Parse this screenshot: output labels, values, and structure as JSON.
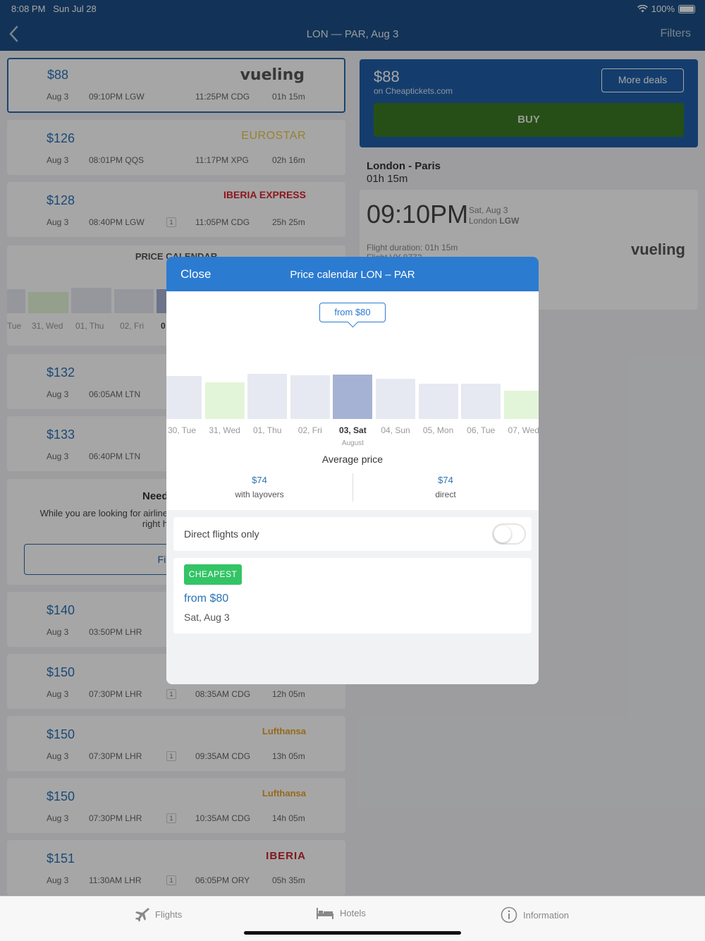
{
  "status": {
    "time": "8:08 PM",
    "date": "Sun Jul 28",
    "battery": "100%"
  },
  "nav": {
    "title": "LON — PAR, Aug 3",
    "filters": "Filters"
  },
  "flights": [
    {
      "price": "$88",
      "date": "Aug 3",
      "depart": "09:10PM LGW",
      "stops": "",
      "arrive": "11:25PM CDG",
      "duration": "01h 15m",
      "airline": "vueling",
      "selected": true
    },
    {
      "price": "$126",
      "date": "Aug 3",
      "depart": "08:01PM QQS",
      "stops": "",
      "arrive": "11:17PM XPG",
      "duration": "02h 16m",
      "airline": "EUROSTAR"
    },
    {
      "price": "$128",
      "date": "Aug 3",
      "depart": "08:40PM LGW",
      "stops": "1",
      "arrive": "11:05PM CDG",
      "duration": "25h 25m",
      "airline": "IBERIA EXPRESS"
    },
    {
      "price": "$132",
      "date": "Aug 3",
      "depart": "06:05AM LTN",
      "stops": "",
      "arrive": "",
      "duration": "",
      "airline": ""
    },
    {
      "price": "$133",
      "date": "Aug 3",
      "depart": "06:40PM LTN",
      "stops": "",
      "arrive": "",
      "duration": "",
      "airline": ""
    },
    {
      "price": "$140",
      "date": "Aug 3",
      "depart": "03:50PM LHR",
      "stops": "",
      "arrive": "",
      "duration": "",
      "airline": ""
    },
    {
      "price": "$150",
      "date": "Aug 3",
      "depart": "07:30PM LHR",
      "stops": "1",
      "arrive": "08:35AM CDG",
      "duration": "12h 05m",
      "airline": ""
    },
    {
      "price": "$150",
      "date": "Aug 3",
      "depart": "07:30PM LHR",
      "stops": "1",
      "arrive": "09:35AM CDG",
      "duration": "13h 05m",
      "airline": "Lufthansa"
    },
    {
      "price": "$150",
      "date": "Aug 3",
      "depart": "07:30PM LHR",
      "stops": "1",
      "arrive": "10:35AM CDG",
      "duration": "14h 05m",
      "airline": "Lufthansa"
    },
    {
      "price": "$151",
      "date": "Aug 3",
      "depart": "11:30AM LHR",
      "stops": "1",
      "arrive": "06:05PM ORY",
      "duration": "05h 35m",
      "airline": "IBERIA"
    }
  ],
  "background_calendar": {
    "title": "PRICE CALENDAR",
    "labels": [
      "Tue",
      "31, Wed",
      "01, Thu",
      "02, Fri",
      "0"
    ]
  },
  "need_card": {
    "title": "Need",
    "text1": "While you are looking for airline",
    "text2": "right h",
    "button": "Fin"
  },
  "deal_panel": {
    "price": "$88",
    "provider": "on Cheaptickets.com",
    "more_deals": "More deals",
    "buy": "BUY"
  },
  "route": {
    "name": "London - Paris",
    "duration": "01h 15m"
  },
  "flight_detail": {
    "time": "09:10PM",
    "date": "Sat, Aug 3",
    "airport_city": "London",
    "airport_code": "LGW",
    "duration_label": "Flight duration: 01h 15m",
    "flight_no": "Flight VY 8772",
    "logo": "vueling"
  },
  "modal": {
    "close": "Close",
    "title": "Price calendar LON – PAR",
    "tooltip": "from $80",
    "month_label": "August",
    "avg_title": "Average price",
    "avg_layovers_value": "$74",
    "avg_layovers_label": "with layovers",
    "avg_direct_value": "$74",
    "avg_direct_label": "direct",
    "direct_only": "Direct flights only",
    "direct_only_on": false,
    "cheapest_badge": "CHEAPEST",
    "cheapest_price": "from $80",
    "cheapest_date": "Sat, Aug 3"
  },
  "calendar_days": [
    {
      "label": "30, Tue",
      "level": 0.95,
      "kind": "normal"
    },
    {
      "label": "31, Wed",
      "level": 0.81,
      "kind": "cheap"
    },
    {
      "label": "01, Thu",
      "level": 1.0,
      "kind": "normal"
    },
    {
      "label": "02, Fri",
      "level": 0.97,
      "kind": "normal"
    },
    {
      "label": "03, Sat",
      "level": 0.98,
      "kind": "selected"
    },
    {
      "label": "04, Sun",
      "level": 0.89,
      "kind": "normal"
    },
    {
      "label": "05, Mon",
      "level": 0.78,
      "kind": "normal"
    },
    {
      "label": "06, Tue",
      "level": 0.78,
      "kind": "normal"
    },
    {
      "label": "07, Wed",
      "level": 0.63,
      "kind": "cheap"
    }
  ],
  "tabs": [
    {
      "label": "Flights",
      "icon": "airplane-icon"
    },
    {
      "label": "Hotels",
      "icon": "bed-icon"
    },
    {
      "label": "Information",
      "icon": "info-icon"
    }
  ],
  "colors": {
    "brand": "#1c4f86",
    "accent": "#2b7bd1",
    "buy": "#3a7a22",
    "cheapest": "#34c466",
    "bar": "#e6e9f1",
    "bar_selected": "#a5b2d3",
    "bar_cheap": "#e3f5d8"
  }
}
